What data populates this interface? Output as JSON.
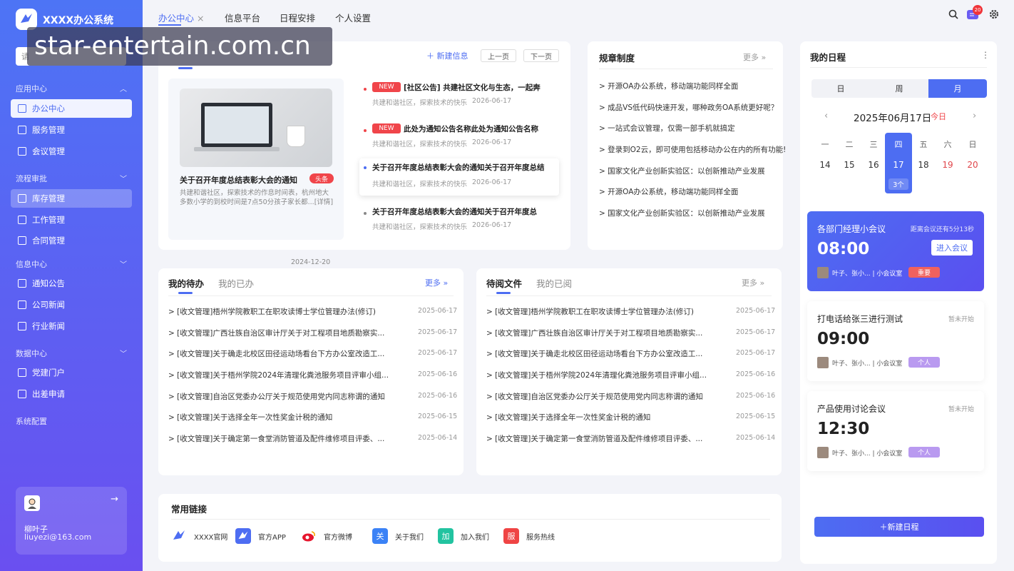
{
  "app": {
    "title": "XXXX办公系统",
    "search_placeholder": "请"
  },
  "sidebar": {
    "groups": [
      {
        "label": "应用中心",
        "items": [
          "办公中心",
          "服务管理",
          "会议管理"
        ]
      },
      {
        "label": "流程审批",
        "items": [
          "库存管理",
          "工作管理",
          "合同管理"
        ]
      },
      {
        "label": "信息中心",
        "items": [
          "通知公告",
          "公司新闻",
          "行业新闻"
        ]
      },
      {
        "label": "数据中心",
        "items": [
          "党建门户",
          "出差申请"
        ]
      }
    ],
    "system_config": "系统配置"
  },
  "user": {
    "name": "柳叶子",
    "email": "liuyezi@163.com"
  },
  "topbar": {
    "tabs": [
      "办公中心",
      "信息平台",
      "日程安排",
      "个人设置"
    ],
    "close_glyph": "×",
    "message_count": "20"
  },
  "watermark": "star-entertain.com.cn",
  "news": {
    "add_label": "新建信息",
    "prev_label": "上一页",
    "next_label": "下一页",
    "feature": {
      "title": "关于召开年度总结表彰大会的通知",
      "badge": "头条",
      "desc": "共建和谐社区，探索技术的作息时间表，杭州地大多数小学的到校时间是7点50分孩子家长都...[详情]",
      "date": "2024-12-20"
    },
    "items": [
      {
        "badge": "NEW",
        "title": "[社区公告] 共建社区文化与生态，一起奔",
        "source": "共建和谐社区，探索技术的快乐",
        "date": "2026-06-17"
      },
      {
        "badge": "NEW",
        "title": "此处为通知公告名称此处为通知公告名称",
        "source": "共建和谐社区，探索技术的快乐",
        "date": "2026-06-17"
      },
      {
        "badge": "",
        "title": "关于召开年度总结表彰大会的通知关于召开年度总结",
        "source": "共建和谐社区，探索技术的快乐",
        "date": "2026-06-17"
      },
      {
        "badge": "",
        "title": "关于召开年度总结表彰大会的通知关于召开年度总",
        "source": "共建和谐社区，探索技术的快乐",
        "date": "2026-06-17"
      }
    ]
  },
  "rules": {
    "title": "规章制度",
    "more": "更多",
    "items": [
      "> 开源OA办公系统，移动端功能同样全面",
      "> 成品VS低代码快速开发，哪种政务OA系统更好呢？",
      "> 一站式会议管理，仅需一部手机就搞定",
      "> 登录到O2云，即可使用包括移动办公在内的所有功能!",
      "> 国家文化产业创新实验区：以创新推动产业发展",
      "> 开源OA办公系统，移动端功能同样全面",
      "> 国家文化产业创新实验区：以创新推动产业发展"
    ]
  },
  "todo": {
    "tab_active": "我的待办",
    "tab_other": "我的已办",
    "more": "更多",
    "items": [
      {
        "text": "> [收文管理]梧州学院教职工在职攻读博士学位管理办法(修订)",
        "date": "2025-06-17"
      },
      {
        "text": "> [收文管理]广西壮族自治区审计厅关于对工程项目地质勘察实...",
        "date": "2025-06-17"
      },
      {
        "text": "> [收文管理]关于确走北校区田径运动场看台下方办公室改造工...",
        "date": "2025-06-17"
      },
      {
        "text": "> [收文管理]关于梧州学院2024年清理化粪池服务项目评审小组...",
        "date": "2025-06-16"
      },
      {
        "text": "> [收文管理]自治区党委办公厅关于规范使用党内同志称谓的通知",
        "date": "2025-06-16"
      },
      {
        "text": "> [收文管理]关于选择全年一次性奖金计税的通知",
        "date": "2025-06-15"
      },
      {
        "text": "> [收文管理]关于确定第一食堂消防管道及配件维修项目评委、...",
        "date": "2025-06-14"
      }
    ]
  },
  "reading": {
    "tab_active": "待阅文件",
    "tab_other": "我的已阅",
    "more": "更多",
    "items": [
      {
        "text": "> [收文管理]梧州学院教职工在职攻读博士学位管理办法(修订)",
        "date": "2025-06-17"
      },
      {
        "text": "> [收文管理]广西壮族自治区审计厅关于对工程项目地质勘察实...",
        "date": "2025-06-17"
      },
      {
        "text": "> [收文管理]关于确走北校区田径运动场看台下方办公室改造工...",
        "date": "2025-06-17"
      },
      {
        "text": "> [收文管理]关于梧州学院2024年清理化粪池服务项目评审小组...",
        "date": "2025-06-16"
      },
      {
        "text": "> [收文管理]自治区党委办公厅关于规范使用党内同志称谓的通知",
        "date": "2025-06-16"
      },
      {
        "text": "> [收文管理]关于选择全年一次性奖金计税的通知",
        "date": "2025-06-15"
      },
      {
        "text": "> [收文管理]关于确定第一食堂消防管道及配件维修项目评委、...",
        "date": "2025-06-14"
      }
    ]
  },
  "links": {
    "title": "常用链接",
    "items": [
      {
        "label": "XXXX官网",
        "glyph": "",
        "color": "#ffffff"
      },
      {
        "label": "官方APP",
        "glyph": "",
        "color": "#4d6df2"
      },
      {
        "label": "官方微博",
        "glyph": "",
        "color": "#ffffff"
      },
      {
        "label": "关于我们",
        "glyph": "关",
        "color": "#3b82f6"
      },
      {
        "label": "加入我们",
        "glyph": "加",
        "color": "#22c3a0"
      },
      {
        "label": "服务热线",
        "glyph": "服",
        "color": "#ef4444"
      }
    ]
  },
  "schedule": {
    "title": "我的日程",
    "tabs": [
      "日",
      "周",
      "月"
    ],
    "date": "2025年06月17日",
    "today": "今日",
    "weekdays": [
      "一",
      "二",
      "三",
      "四",
      "五",
      "六",
      "日"
    ],
    "days": [
      "14",
      "15",
      "16",
      "17",
      "18",
      "19",
      "20"
    ],
    "today_count": "3个",
    "meetings": [
      {
        "title": "各部门经理小会议",
        "status": "距离会议还有5分13秒",
        "time": "08:00",
        "people": "叶子、张小...  |  小会议室",
        "tag": "重要",
        "join": "进入会议"
      },
      {
        "title": "打电话给张三进行测试",
        "status": "暂未开始",
        "time": "09:00",
        "people": "叶子、张小...  |  小会议室",
        "tag": "个人"
      },
      {
        "title": "产品使用讨论会议",
        "status": "暂未开始",
        "time": "12:30",
        "people": "叶子、张小...  |  小会议室",
        "tag": "个人"
      }
    ],
    "new_label": "新建日程"
  }
}
